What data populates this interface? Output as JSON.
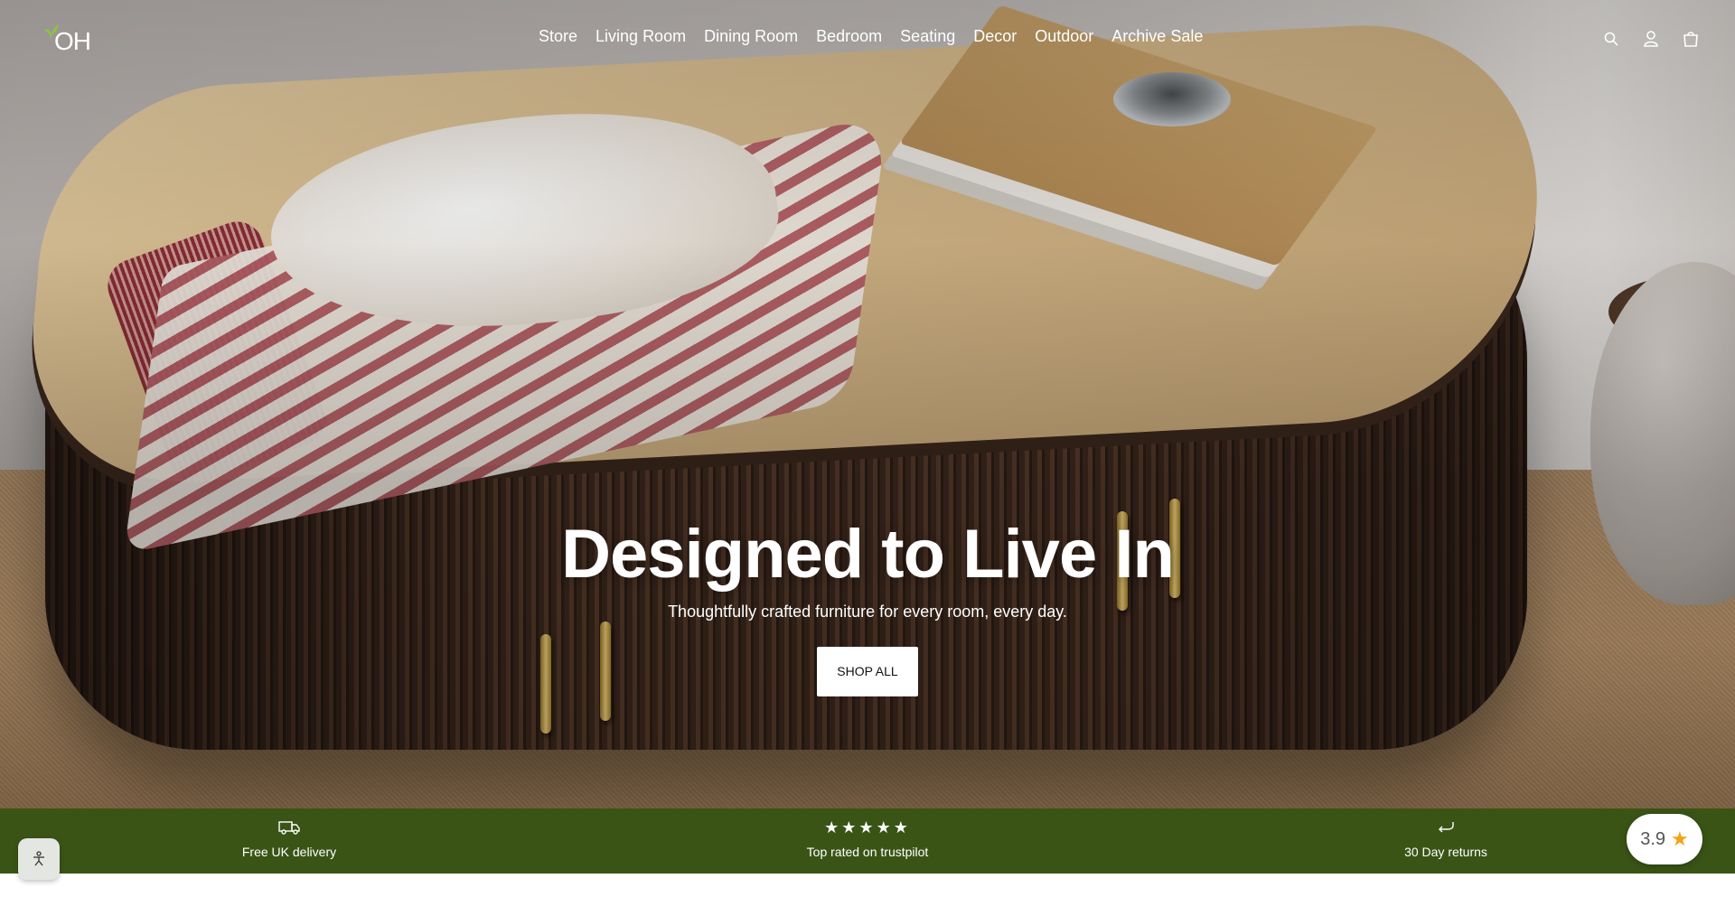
{
  "header": {
    "logo_text": "OH",
    "nav": [
      {
        "label": "Store"
      },
      {
        "label": "Living Room"
      },
      {
        "label": "Dining Room"
      },
      {
        "label": "Bedroom"
      },
      {
        "label": "Seating"
      },
      {
        "label": "Decor"
      },
      {
        "label": "Outdoor"
      },
      {
        "label": "Archive Sale"
      }
    ],
    "icons": [
      "search-icon",
      "account-icon",
      "cart-icon"
    ]
  },
  "hero": {
    "title": "Designed to Live In",
    "subtitle": "Thoughtfully crafted furniture for every room, every day.",
    "cta_label": "SHOP ALL"
  },
  "features": [
    {
      "icon": "delivery-truck-icon",
      "label": "Free UK delivery"
    },
    {
      "icon": "five-stars-icon",
      "stars": "★★★★★",
      "label": "Top rated on trustpilot"
    },
    {
      "icon": "return-arrow-icon",
      "label": "30 Day returns"
    }
  ],
  "rating_widget": {
    "value": "3.9",
    "icon": "star-icon"
  },
  "accessibility_widget": {
    "icon": "accessibility-icon"
  },
  "colors": {
    "feature_bar": "#3a5416",
    "logo_leaf": "#8cc63f",
    "rating_star": "#f2a214"
  }
}
